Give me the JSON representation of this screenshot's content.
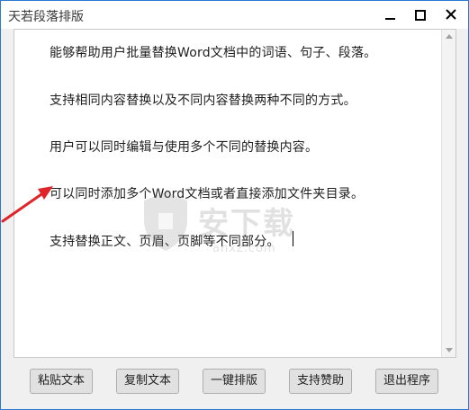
{
  "window": {
    "title": "天若段落排版"
  },
  "editor": {
    "lines": [
      "能够帮助用户批量替换Word文档中的词语、句子、段落。",
      "支持相同内容替换以及不同内容替换两种不同的方式。",
      "用户可以同时编辑与使用多个不同的替换内容。",
      "可以同时添加多个Word文档或者直接添加文件夹目录。",
      "支持替换正文、页眉、页脚等不同部分。"
    ]
  },
  "watermark": {
    "text": "安下载",
    "sub": "anxz.com"
  },
  "buttons": {
    "paste": "粘贴文本",
    "copy": "复制文本",
    "format": "一键排版",
    "support": "支持赞助",
    "exit": "退出程序"
  },
  "colors": {
    "accent_border": "#2b78d0",
    "annotation_arrow": "#e0242a"
  },
  "icons": {
    "minimize": "minimize-icon",
    "maximize": "maximize-icon",
    "close": "close-icon"
  }
}
